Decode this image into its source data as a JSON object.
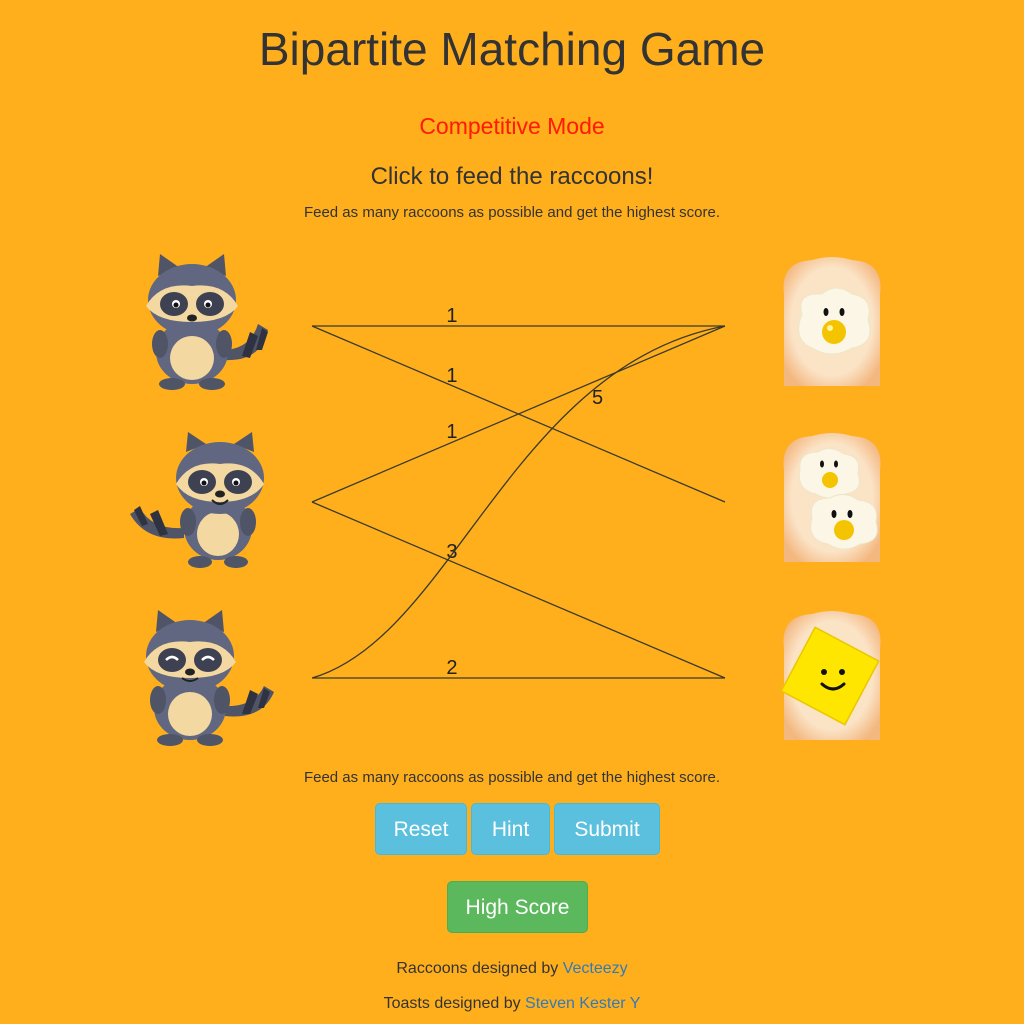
{
  "header": {
    "title": "Bipartite Matching Game",
    "mode": "Competitive Mode",
    "subtitle": "Click to feed the raccoons!",
    "instruction": "Feed as many raccoons as possible and get the highest score."
  },
  "graph": {
    "raccoons": [
      {
        "name": "raccoon-1"
      },
      {
        "name": "raccoon-2"
      },
      {
        "name": "raccoon-3"
      }
    ],
    "toasts": [
      {
        "name": "toast-one-egg"
      },
      {
        "name": "toast-two-eggs"
      },
      {
        "name": "toast-butter"
      }
    ],
    "edges": [
      {
        "from": 0,
        "to": 0,
        "weight": "1"
      },
      {
        "from": 0,
        "to": 1,
        "weight": "1"
      },
      {
        "from": 1,
        "to": 0,
        "weight": "1"
      },
      {
        "from": 1,
        "to": 2,
        "weight": "3"
      },
      {
        "from": 2,
        "to": 0,
        "weight": "5"
      },
      {
        "from": 2,
        "to": 2,
        "weight": "2"
      }
    ]
  },
  "footer_instruction": "Feed as many raccoons as possible and get the highest score.",
  "buttons": {
    "reset": "Reset",
    "hint": "Hint",
    "submit": "Submit",
    "high_score": "High Score"
  },
  "credits": {
    "raccoons_prefix": "Raccoons designed by ",
    "raccoons_link": "Vecteezy",
    "toasts_prefix": "Toasts designed by ",
    "toasts_link": "Steven Kester Y"
  },
  "colors": {
    "background": "#FFAF1C",
    "mode": "#FF1A00",
    "info_button": "#5bc0de",
    "success_button": "#5cb85c",
    "link": "#337ab7"
  }
}
